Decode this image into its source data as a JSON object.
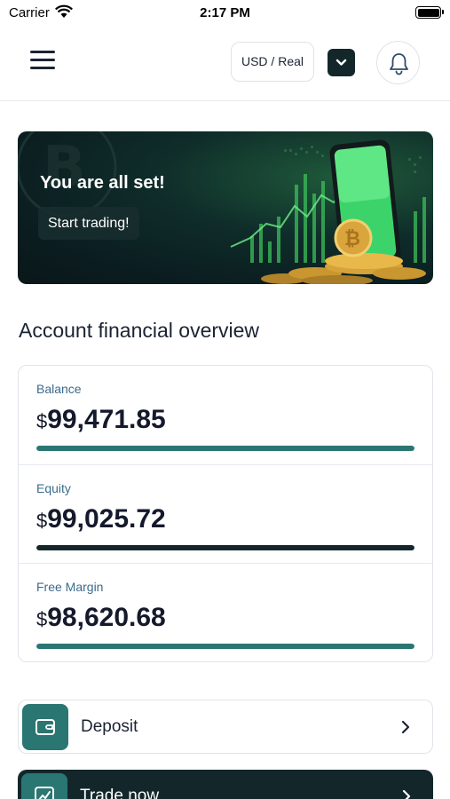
{
  "status_bar": {
    "carrier": "Carrier",
    "time": "2:17 PM"
  },
  "header": {
    "currency_label": "USD / Real"
  },
  "banner": {
    "title": "You are all set!",
    "cta": "Start trading!"
  },
  "overview": {
    "title": "Account financial overview",
    "metrics": [
      {
        "label": "Balance",
        "currency": "$",
        "value": "99,471.85",
        "bar_color": "#2a7672",
        "bar_level": 1.0
      },
      {
        "label": "Equity",
        "currency": "$",
        "value": "99,025.72",
        "bar_color": "#13272b",
        "bar_level": 1.0
      },
      {
        "label": "Free Margin",
        "currency": "$",
        "value": "98,620.68",
        "bar_color": "#2a7672",
        "bar_level": 1.0
      }
    ]
  },
  "actions": {
    "deposit": {
      "label": "Deposit",
      "icon": "wallet-icon"
    },
    "trade": {
      "label": "Trade now",
      "icon": "chart-icon"
    }
  },
  "colors": {
    "accent": "#2a7672",
    "dark": "#13272b",
    "label": "#3b6b8c"
  }
}
